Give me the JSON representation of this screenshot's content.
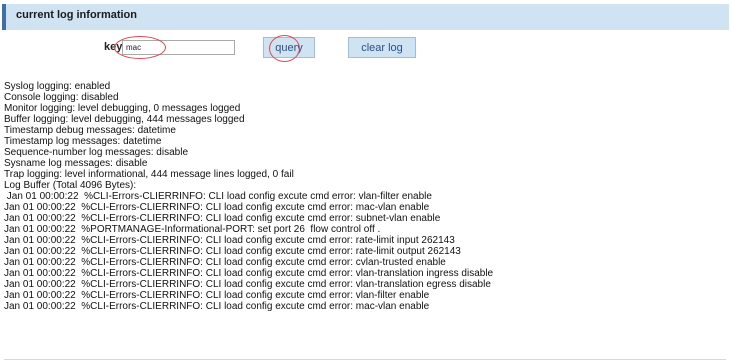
{
  "section": {
    "title": "current log information"
  },
  "search": {
    "label": "key",
    "value": "mac"
  },
  "buttons": {
    "query": "query",
    "clear": "clear log"
  },
  "log": {
    "lines": [
      "Syslog logging: enabled",
      "Console logging: disabled",
      "Monitor logging: level debugging, 0 messages logged",
      "Buffer logging: level debugging, 444 messages logged",
      "Timestamp debug messages: datetime",
      "Timestamp log messages: datetime",
      "Sequence-number log messages: disable",
      "Sysname log messages: disable",
      "Trap logging: level informational, 444 message lines logged, 0 fail",
      "Log Buffer (Total 4096 Bytes):",
      " Jan 01 00:00:22  %CLI-Errors-CLIERRINFO: CLI load config excute cmd error: vlan-filter enable",
      "Jan 01 00:00:22  %CLI-Errors-CLIERRINFO: CLI load config excute cmd error: mac-vlan enable",
      "Jan 01 00:00:22  %CLI-Errors-CLIERRINFO: CLI load config excute cmd error: subnet-vlan enable",
      "Jan 01 00:00:22  %PORTMANAGE-Informational-PORT: set port 26  flow control off .",
      "Jan 01 00:00:22  %CLI-Errors-CLIERRINFO: CLI load config excute cmd error: rate-limit input 262143",
      "Jan 01 00:00:22  %CLI-Errors-CLIERRINFO: CLI load config excute cmd error: rate-limit output 262143",
      "Jan 01 00:00:22  %CLI-Errors-CLIERRINFO: CLI load config excute cmd error: cvlan-trusted enable",
      "Jan 01 00:00:22  %CLI-Errors-CLIERRINFO: CLI load config excute cmd error: vlan-translation ingress disable",
      "Jan 01 00:00:22  %CLI-Errors-CLIERRINFO: CLI load config excute cmd error: vlan-translation egress disable",
      "Jan 01 00:00:22  %CLI-Errors-CLIERRINFO: CLI load config excute cmd error: vlan-filter enable",
      "Jan 01 00:00:22  %CLI-Errors-CLIERRINFO: CLI load config excute cmd error: mac-vlan enable"
    ]
  },
  "colors": {
    "header_bg": "#cfe3f3",
    "header_accent": "#3d6fa8",
    "button_bg": "#cfe3f3",
    "button_text": "#2b4f86",
    "annotation": "#d94a57"
  }
}
